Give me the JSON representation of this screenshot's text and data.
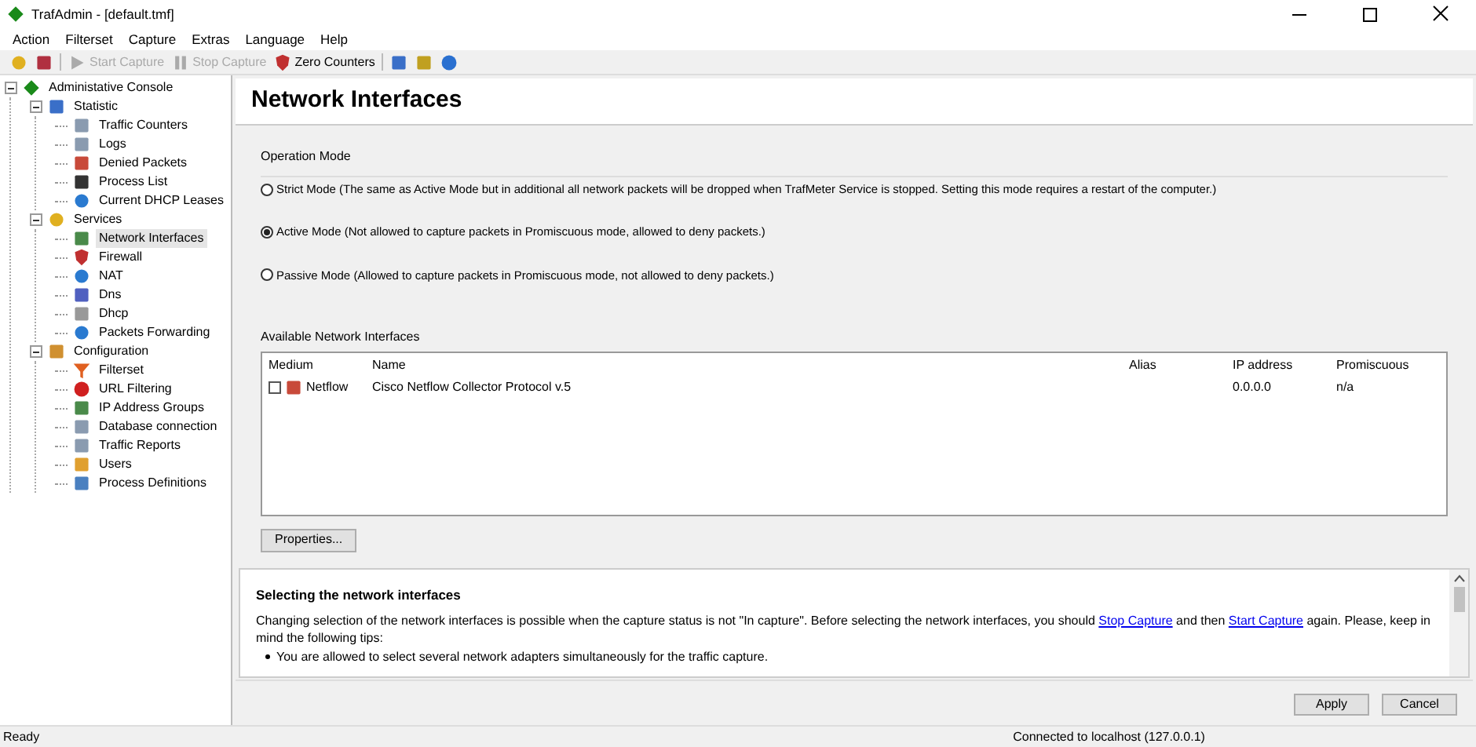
{
  "window": {
    "title": "TrafAdmin - [default.tmf]"
  },
  "menu": [
    "Action",
    "Filterset",
    "Capture",
    "Extras",
    "Language",
    "Help"
  ],
  "toolbar": [
    {
      "kind": "icon",
      "disabled": false
    },
    {
      "kind": "icon",
      "disabled": false
    },
    {
      "kind": "sep"
    },
    {
      "kind": "text",
      "label": "Start Capture",
      "disabled": true
    },
    {
      "kind": "text",
      "label": "Stop Capture",
      "disabled": true
    },
    {
      "kind": "text",
      "label": "Zero Counters",
      "disabled": false
    },
    {
      "kind": "sep"
    },
    {
      "kind": "icon",
      "disabled": false
    },
    {
      "kind": "icon",
      "disabled": false
    },
    {
      "kind": "icon",
      "disabled": false
    }
  ],
  "tree": [
    {
      "label": "Administative Console",
      "expanded": true,
      "selected": false,
      "children": [
        {
          "label": "Statistic",
          "expanded": true,
          "selected": false,
          "children": [
            {
              "label": "Traffic Counters",
              "selected": false
            },
            {
              "label": "Logs",
              "selected": false
            },
            {
              "label": "Denied Packets",
              "selected": false
            },
            {
              "label": "Process List",
              "selected": false
            },
            {
              "label": "Current DHCP Leases",
              "selected": false
            }
          ]
        },
        {
          "label": "Services",
          "expanded": true,
          "selected": false,
          "children": [
            {
              "label": "Network Interfaces",
              "selected": true
            },
            {
              "label": "Firewall",
              "selected": false
            },
            {
              "label": "NAT",
              "selected": false
            },
            {
              "label": "Dns",
              "selected": false
            },
            {
              "label": "Dhcp",
              "selected": false
            },
            {
              "label": "Packets Forwarding",
              "selected": false
            }
          ]
        },
        {
          "label": "Configuration",
          "expanded": true,
          "selected": false,
          "children": [
            {
              "label": "Filterset",
              "selected": false
            },
            {
              "label": "URL Filtering",
              "selected": false
            },
            {
              "label": "IP Address Groups",
              "selected": false
            },
            {
              "label": "Database connection",
              "selected": false
            },
            {
              "label": "Traffic Reports",
              "selected": false
            },
            {
              "label": "Users",
              "selected": false
            },
            {
              "label": "Process Definitions",
              "selected": false
            }
          ]
        }
      ]
    }
  ],
  "page": {
    "title": "Network Interfaces",
    "operation_mode": {
      "label": "Operation Mode",
      "options": [
        {
          "label": "Strict Mode (The same as Active Mode but in additional all network packets will be dropped when TrafMeter Service is stopped. Setting this mode requires a restart of the computer.)",
          "selected": false
        },
        {
          "label": "Active Mode (Not allowed to capture packets in Promiscuous mode, allowed to deny packets.)",
          "selected": true
        },
        {
          "label": "Passive Mode (Allowed to capture packets in Promiscuous mode, not allowed to deny packets.)",
          "selected": false
        }
      ]
    },
    "interfaces": {
      "label": "Available Network Interfaces",
      "columns": [
        "Medium",
        "Name",
        "Alias",
        "IP address",
        "Promiscuous"
      ],
      "rows": [
        {
          "checked": false,
          "medium": "Netflow",
          "name": "Cisco Netflow Collector Protocol v.5",
          "ip": "0.0.0.0",
          "promiscuous": "n/a"
        }
      ],
      "button": "Properties..."
    },
    "help": {
      "title": "Selecting the network interfaces",
      "text_before": "Changing selection of the network interfaces is possible when the capture status is not \"In capture\". Before selecting the network interfaces, you should",
      "link1": "Stop Capture",
      "text_mid": "and then",
      "link2": "Start Capture",
      "text_after": "again. Please, keep in mind the following tips:",
      "bullets": [
        "You are allowed to select several network adapters simultaneously for the traffic capture."
      ]
    },
    "buttons": [
      "Apply",
      "Cancel"
    ]
  },
  "status_bar": {
    "left": "Ready",
    "right": "Connected to localhost (127.0.0.1)"
  }
}
